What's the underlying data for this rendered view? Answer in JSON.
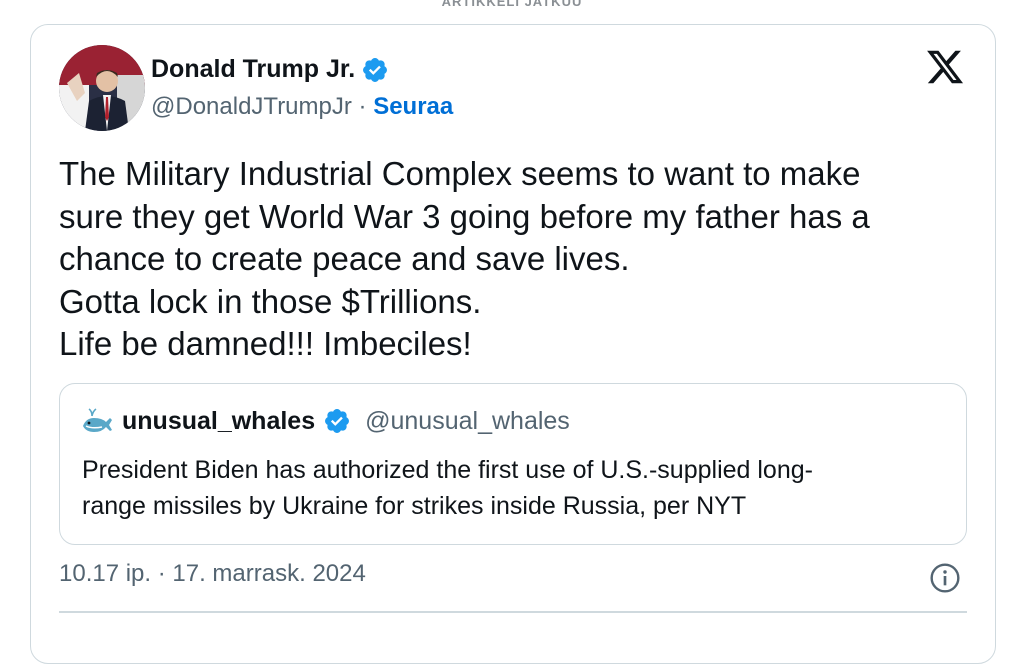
{
  "header_label": "ARTIKKELI JATKUU",
  "tweet": {
    "author": {
      "display_name": "Donald Trump Jr.",
      "handle": "@DonaldJTrumpJr",
      "separator": " · ",
      "follow_label": "Seuraa",
      "verified": true
    },
    "text_lines": [
      "The Military Industrial Complex seems to want to make",
      "sure they get World War 3 going before my father has a",
      "chance to create peace and save lives.",
      "Gotta lock in those $Trillions.",
      "Life be damned!!! Imbeciles!"
    ],
    "quote": {
      "display_name": "unusual_whales",
      "handle": "@unusual_whales",
      "avatar_icon": "whale-icon",
      "verified": true,
      "text_lines": [
        "President Biden has authorized the first use of U.S.-supplied long-",
        "range missiles by Ukraine for strikes inside Russia, per NYT"
      ]
    },
    "timestamp": "10.17 ip. · 17. marrask. 2024"
  },
  "icons": {
    "platform": "x-logo-icon",
    "verified": "verified-badge-icon",
    "info": "info-icon"
  },
  "colors": {
    "link_blue": "#006fd6",
    "verified_blue": "#1d9bf0",
    "text_primary": "#0f1419",
    "text_secondary": "#536471",
    "border": "#cfd9de"
  }
}
